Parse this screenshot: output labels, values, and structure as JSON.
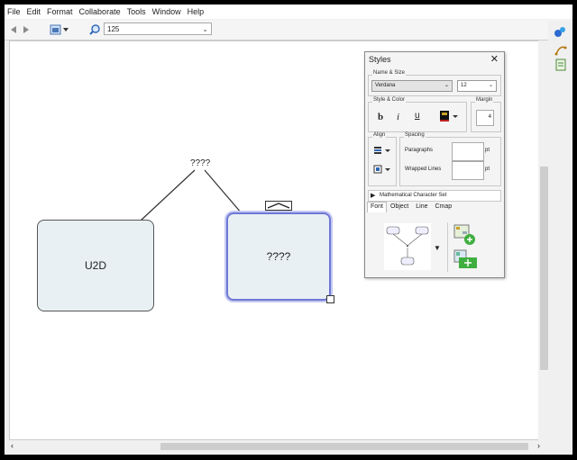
{
  "menubar": [
    "File",
    "Edit",
    "Format",
    "Collaborate",
    "Tools",
    "Window",
    "Help"
  ],
  "toolbar": {
    "zoom_value": "125"
  },
  "map": {
    "concept1": "U2D",
    "concept2": "????",
    "link_label": "????"
  },
  "styles_panel": {
    "title": "Styles",
    "name_size_label": "Name & Size",
    "font_name": "Verdana",
    "font_size": "12",
    "style_color_label": "Style & Color",
    "bold": "b",
    "italic": "i",
    "underline": "u",
    "margin_label": "Margin",
    "margin_value": "4",
    "align_label": "Align",
    "spacing_label": "Spacing",
    "paragraphs_label": "Paragraphs",
    "wrapped_lines_label": "Wrapped Lines",
    "pt1": "pt",
    "pt2": "pt",
    "math_set": "Mathematical Character Set",
    "tabs": [
      "Font",
      "Object",
      "Line",
      "Cmap"
    ]
  }
}
